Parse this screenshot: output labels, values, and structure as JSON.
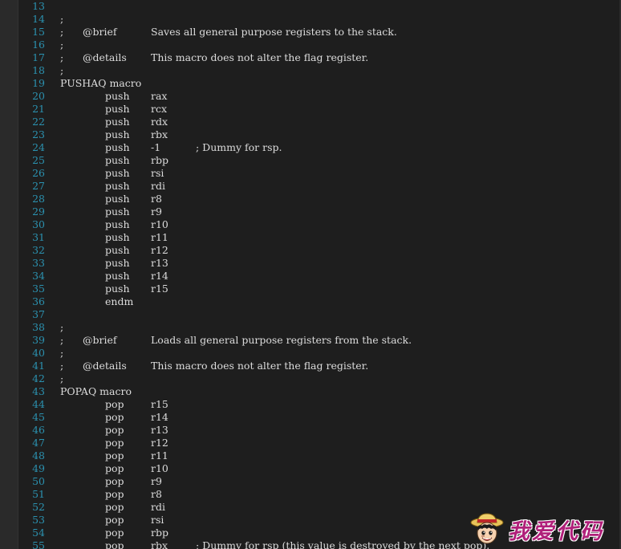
{
  "editor": {
    "lines": [
      {
        "n": "13",
        "kind": "blank"
      },
      {
        "n": "14",
        "kind": "semi",
        "semi": ";"
      },
      {
        "n": "15",
        "kind": "doc",
        "semi": ";",
        "tag": "@brief",
        "desc": "Saves all general purpose registers to the stack."
      },
      {
        "n": "16",
        "kind": "semi",
        "semi": ";"
      },
      {
        "n": "17",
        "kind": "doc",
        "semi": ";",
        "tag": "@details",
        "desc": "This macro does not alter the flag register."
      },
      {
        "n": "18",
        "kind": "semi",
        "semi": ";"
      },
      {
        "n": "19",
        "kind": "plain",
        "text": "PUSHAQ macro"
      },
      {
        "n": "20",
        "kind": "instr",
        "kw": "push",
        "op": "rax"
      },
      {
        "n": "21",
        "kind": "instr",
        "kw": "push",
        "op": "rcx"
      },
      {
        "n": "22",
        "kind": "instr",
        "kw": "push",
        "op": "rdx"
      },
      {
        "n": "23",
        "kind": "instr",
        "kw": "push",
        "op": "rbx"
      },
      {
        "n": "24",
        "kind": "instr",
        "kw": "push",
        "op": "-1",
        "cm": "; Dummy for rsp."
      },
      {
        "n": "25",
        "kind": "instr",
        "kw": "push",
        "op": "rbp"
      },
      {
        "n": "26",
        "kind": "instr",
        "kw": "push",
        "op": "rsi"
      },
      {
        "n": "27",
        "kind": "instr",
        "kw": "push",
        "op": "rdi"
      },
      {
        "n": "28",
        "kind": "instr",
        "kw": "push",
        "op": "r8"
      },
      {
        "n": "29",
        "kind": "instr",
        "kw": "push",
        "op": "r9"
      },
      {
        "n": "30",
        "kind": "instr",
        "kw": "push",
        "op": "r10"
      },
      {
        "n": "31",
        "kind": "instr",
        "kw": "push",
        "op": "r11"
      },
      {
        "n": "32",
        "kind": "instr",
        "kw": "push",
        "op": "r12"
      },
      {
        "n": "33",
        "kind": "instr",
        "kw": "push",
        "op": "r13"
      },
      {
        "n": "34",
        "kind": "instr",
        "kw": "push",
        "op": "r14"
      },
      {
        "n": "35",
        "kind": "instr",
        "kw": "push",
        "op": "r15"
      },
      {
        "n": "36",
        "kind": "instr",
        "kw": "endm"
      },
      {
        "n": "37",
        "kind": "blank"
      },
      {
        "n": "38",
        "kind": "semi",
        "semi": ";"
      },
      {
        "n": "39",
        "kind": "doc",
        "semi": ";",
        "tag": "@brief",
        "desc": "Loads all general purpose registers from the stack."
      },
      {
        "n": "40",
        "kind": "semi",
        "semi": ";"
      },
      {
        "n": "41",
        "kind": "doc",
        "semi": ";",
        "tag": "@details",
        "desc": "This macro does not alter the flag register."
      },
      {
        "n": "42",
        "kind": "semi",
        "semi": ";"
      },
      {
        "n": "43",
        "kind": "plain",
        "text": "POPAQ macro"
      },
      {
        "n": "44",
        "kind": "instr",
        "kw": "pop",
        "op": "r15"
      },
      {
        "n": "45",
        "kind": "instr",
        "kw": "pop",
        "op": "r14"
      },
      {
        "n": "46",
        "kind": "instr",
        "kw": "pop",
        "op": "r13"
      },
      {
        "n": "47",
        "kind": "instr",
        "kw": "pop",
        "op": "r12"
      },
      {
        "n": "48",
        "kind": "instr",
        "kw": "pop",
        "op": "r11"
      },
      {
        "n": "49",
        "kind": "instr",
        "kw": "pop",
        "op": "r10"
      },
      {
        "n": "50",
        "kind": "instr",
        "kw": "pop",
        "op": "r9"
      },
      {
        "n": "51",
        "kind": "instr",
        "kw": "pop",
        "op": "r8"
      },
      {
        "n": "52",
        "kind": "instr",
        "kw": "pop",
        "op": "rdi"
      },
      {
        "n": "53",
        "kind": "instr",
        "kw": "pop",
        "op": "rsi"
      },
      {
        "n": "54",
        "kind": "instr",
        "kw": "pop",
        "op": "rbp"
      },
      {
        "n": "55",
        "kind": "instr",
        "kw": "pop",
        "op": "rbx",
        "cm": "; Dummy for rsp (this value is destroyed by the next pop)."
      }
    ]
  },
  "watermark": {
    "text": "我爱代码"
  },
  "colors": {
    "background": "#1e1e1e",
    "line_number": "#2b91af",
    "code_text": "#dcdcdc",
    "watermark": "#b0207a"
  },
  "icons": {
    "watermark_logo": "straw-hat-pirate-face-icon"
  }
}
